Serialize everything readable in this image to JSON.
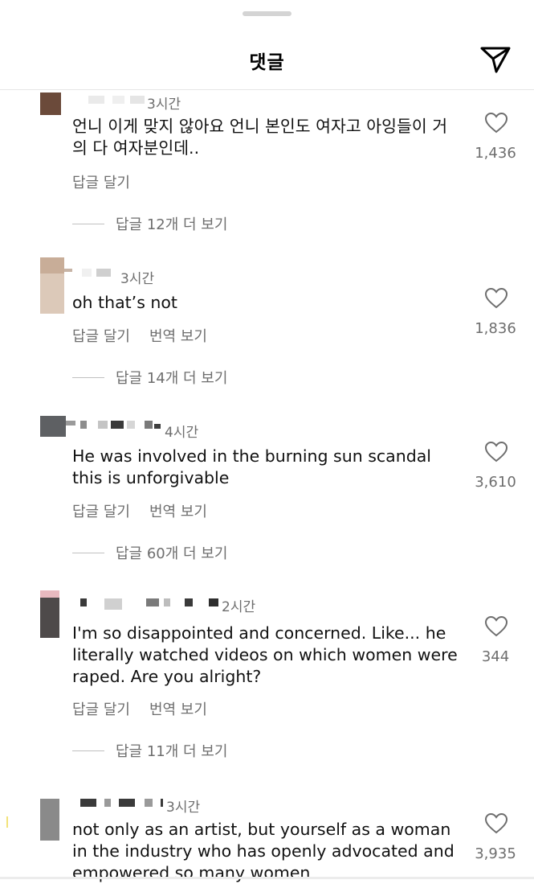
{
  "header": {
    "title": "댓글",
    "icon": "send-icon"
  },
  "actions": {
    "reply": "답글 달기",
    "translate": "번역 보기"
  },
  "comments": [
    {
      "time": "3시간",
      "text": "언니 이게 맞지 않아요 언니 본인도 여자고 아잉들이 거의 다 여자분인데..",
      "likes": "1,436",
      "replies": "답글 12개 더 보기",
      "has_translate": false,
      "avatar_color": "#6b4a3a"
    },
    {
      "time": "3시간",
      "text": "oh that’s not",
      "likes": "1,836",
      "replies": "답글 14개 더 보기",
      "has_translate": true,
      "avatar_color": "#c8ad98"
    },
    {
      "time": "4시간",
      "text": "He was involved in the burning sun scandal this is unforgivable",
      "likes": "3,610",
      "replies": "답글 60개 더 보기",
      "has_translate": true,
      "avatar_color": "#5e6063"
    },
    {
      "time": "2시간",
      "text": "I'm so disappointed and concerned. Like... he literally watched videos on which women were raped. Are you alright?",
      "likes": "344",
      "replies": "답글 11개 더 보기",
      "has_translate": true,
      "avatar_color": "#4e4a4a"
    },
    {
      "time": "3시간",
      "text": "not only as an artist, but yourself as a woman in the industry who has openly advocated and empowered so many women",
      "likes": "3,935",
      "replies": "",
      "has_translate": false,
      "avatar_color": "#8a8a8a"
    }
  ]
}
